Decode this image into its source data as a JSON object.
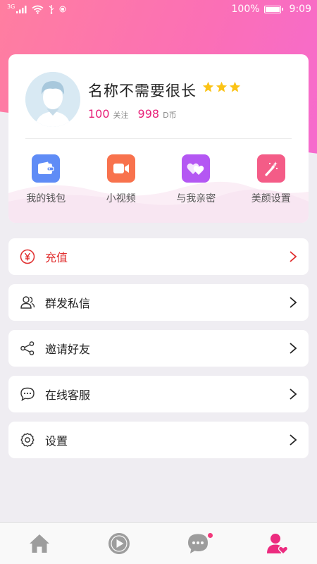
{
  "status_bar": {
    "signal": "3G",
    "battery": "100%",
    "time": "9:09"
  },
  "profile": {
    "name": "名称不需要很长",
    "stars": 3,
    "following_count": "100",
    "following_label": "关注",
    "coins_count": "998",
    "coins_label": "D币"
  },
  "quick_actions": [
    {
      "label": "我的钱包",
      "icon": "wallet-icon",
      "color": "#5f8cf6"
    },
    {
      "label": "小视频",
      "icon": "video-camera-icon",
      "color": "#f8724d"
    },
    {
      "label": "与我亲密",
      "icon": "hearts-icon",
      "color": "#b457f3"
    },
    {
      "label": "美颜设置",
      "icon": "magic-wand-icon",
      "color": "#f45c87"
    }
  ],
  "menu": [
    {
      "label": "充值",
      "icon": "yuan-icon"
    },
    {
      "label": "群发私信",
      "icon": "users-icon"
    },
    {
      "label": "邀请好友",
      "icon": "share-icon"
    },
    {
      "label": "在线客服",
      "icon": "chat-bubble-icon"
    },
    {
      "label": "设置",
      "icon": "gear-icon"
    }
  ],
  "colors": {
    "accent": "#e8227a",
    "recharge": "#e02d2d",
    "gradient_start": "#ff7ea0",
    "gradient_end": "#f56ad2"
  },
  "tabbar": [
    {
      "icon": "home-icon",
      "active": false
    },
    {
      "icon": "play-icon",
      "active": false
    },
    {
      "icon": "message-icon",
      "active": false,
      "badge": true
    },
    {
      "icon": "profile-icon",
      "active": true
    }
  ]
}
